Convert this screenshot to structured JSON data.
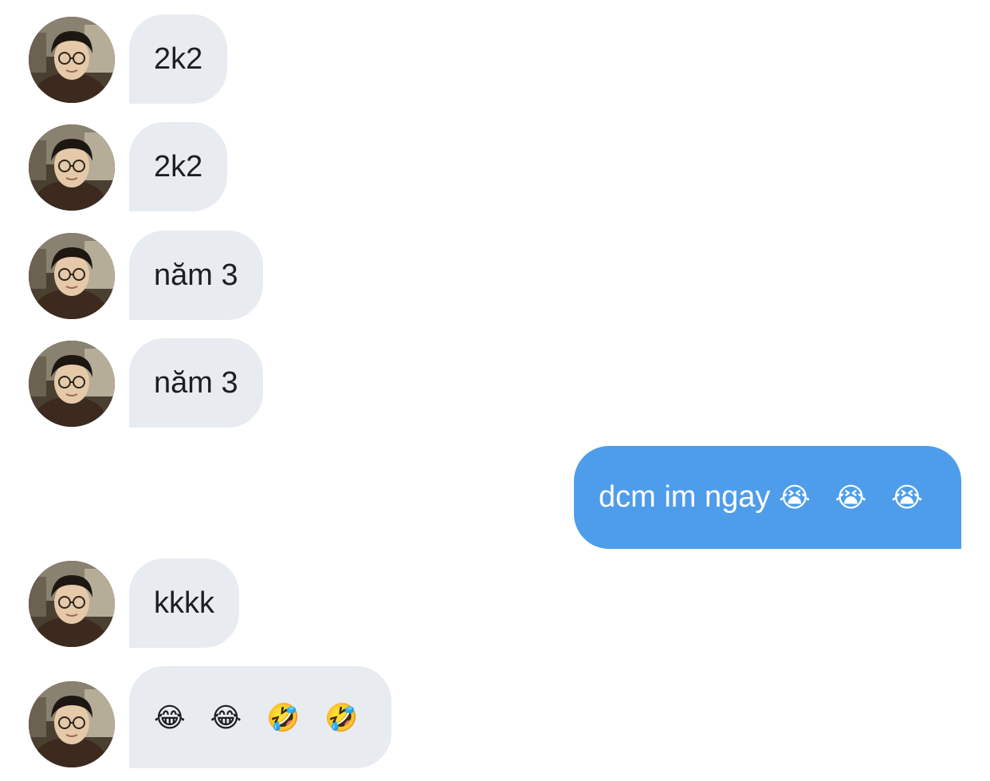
{
  "messages": [
    {
      "sender": "them",
      "text": "2k2"
    },
    {
      "sender": "them",
      "text": "2k2"
    },
    {
      "sender": "them",
      "text": "năm 3"
    },
    {
      "sender": "them",
      "text": "năm 3"
    },
    {
      "sender": "me",
      "text": "dcm im ngay",
      "emoji": "😭 😭 😭"
    },
    {
      "sender": "them",
      "text": "kkkk"
    },
    {
      "sender": "them",
      "emoji": "😂 😂 🤣 🤣"
    }
  ],
  "colors": {
    "incoming_bubble": "#e8ebf0",
    "outgoing_bubble": "#4e9dea",
    "incoming_text": "#1c1e21",
    "outgoing_text": "#ffffff"
  }
}
